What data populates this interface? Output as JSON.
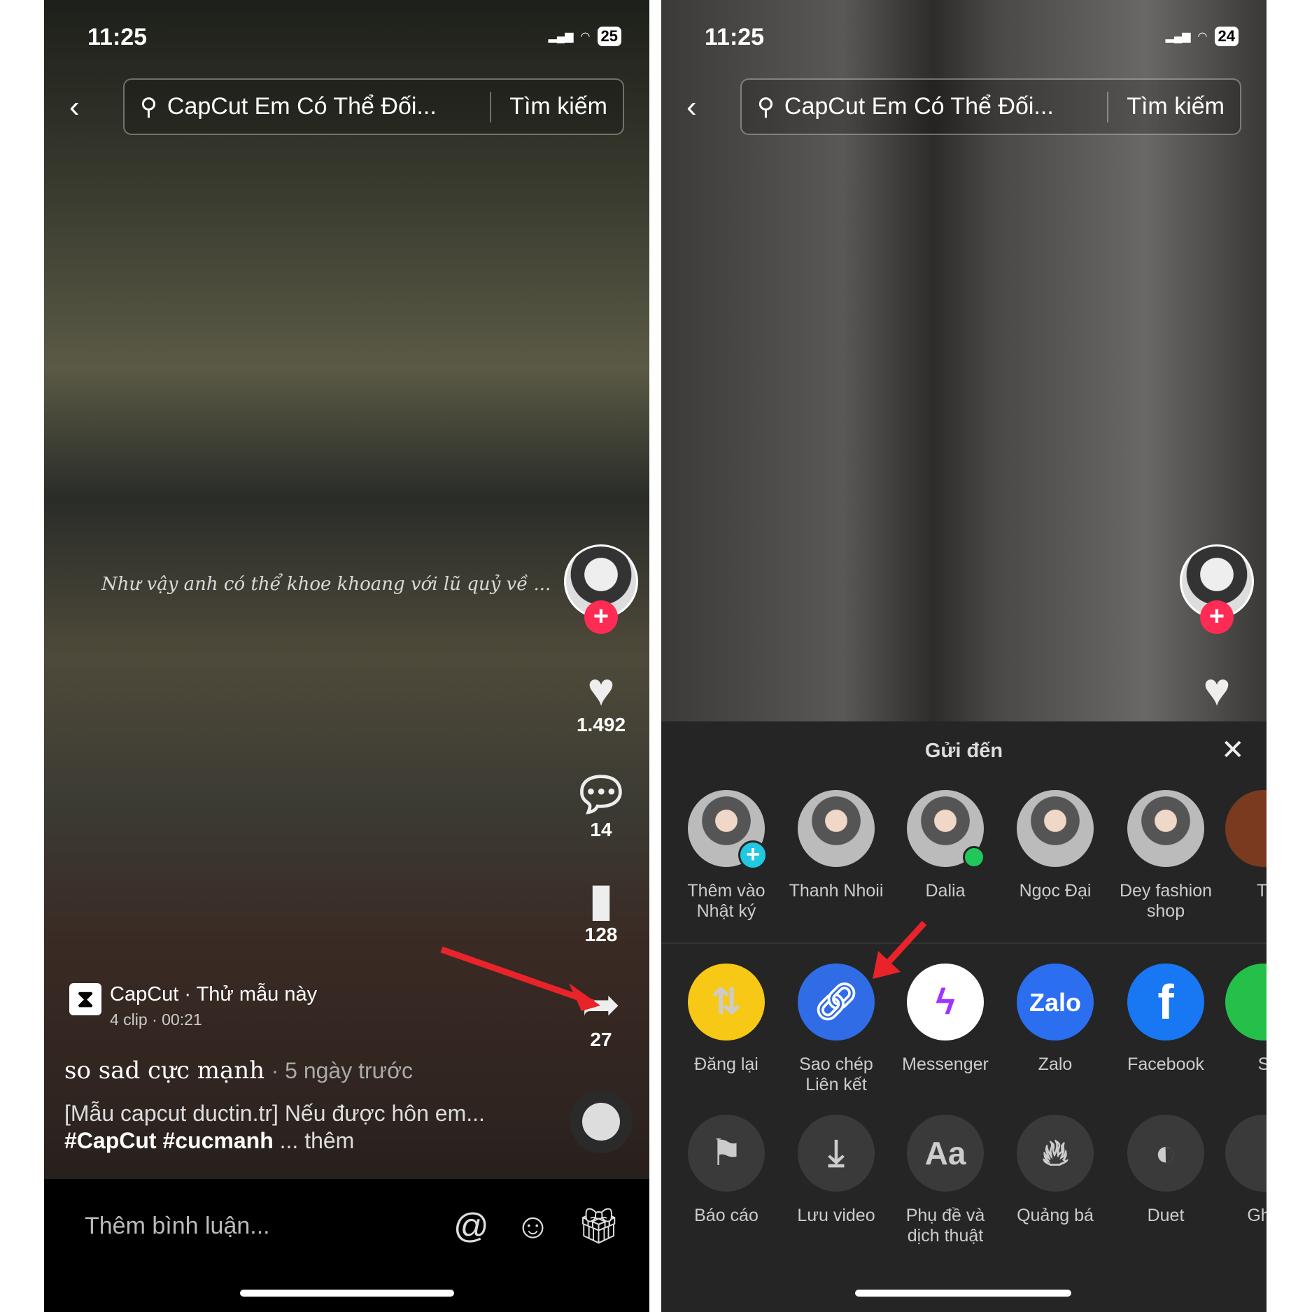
{
  "left": {
    "status": {
      "time": "11:25",
      "battery": "25"
    },
    "search": {
      "query": "CapCut Em Có Thể Đối...",
      "button": "Tìm kiếm"
    },
    "subtitle": "Như vậy anh có thể khoe khoang với lũ quỷ về ...",
    "actions": {
      "likes": "1.492",
      "comments": "14",
      "saves": "128",
      "shares": "27"
    },
    "template": {
      "name": "CapCut · Thử mẫu này",
      "meta": "4 clip · 00:21"
    },
    "author": "so sad cực mạnh",
    "posted": "· 5 ngày trước",
    "caption": "[Mẫu capcut ductin.tr] Nếu được hôn em...",
    "hashtags": "#CapCut #cucmanh",
    "more": "... thêm",
    "comment_placeholder": "Thêm bình luận..."
  },
  "right": {
    "status": {
      "time": "11:25",
      "battery": "24"
    },
    "search": {
      "query": "CapCut Em Có Thể Đối...",
      "button": "Tìm kiếm"
    },
    "sheet": {
      "title": "Gửi đến",
      "contacts": [
        "Thêm vào Nhật ký",
        "Thanh Nhoii",
        "Dalia",
        "Ngọc Đại",
        "Dey fashion shop",
        "Ti"
      ],
      "apps": [
        {
          "label": "Đăng lại",
          "icon": "repost-icon",
          "color": "#f7c815"
        },
        {
          "label": "Sao chép Liên kết",
          "icon": "link-icon",
          "color": "#2f6ce6"
        },
        {
          "label": "Messenger",
          "icon": "messenger-icon",
          "color": "#ffffff"
        },
        {
          "label": "Zalo",
          "icon": "zalo-icon",
          "color": "#2b6ef0"
        },
        {
          "label": "Facebook",
          "icon": "facebook-icon",
          "color": "#1877f2"
        },
        {
          "label": "S",
          "icon": "sms-icon",
          "color": "#25c04a"
        }
      ],
      "tools": [
        {
          "label": "Báo cáo",
          "icon": "flag-icon"
        },
        {
          "label": "Lưu video",
          "icon": "download-icon"
        },
        {
          "label": "Phụ đề và dịch thuật",
          "icon": "captions-icon"
        },
        {
          "label": "Quảng bá",
          "icon": "flame-icon"
        },
        {
          "label": "Duet",
          "icon": "duet-icon"
        },
        {
          "label": "Ghe",
          "icon": "stitch-icon"
        }
      ]
    }
  }
}
